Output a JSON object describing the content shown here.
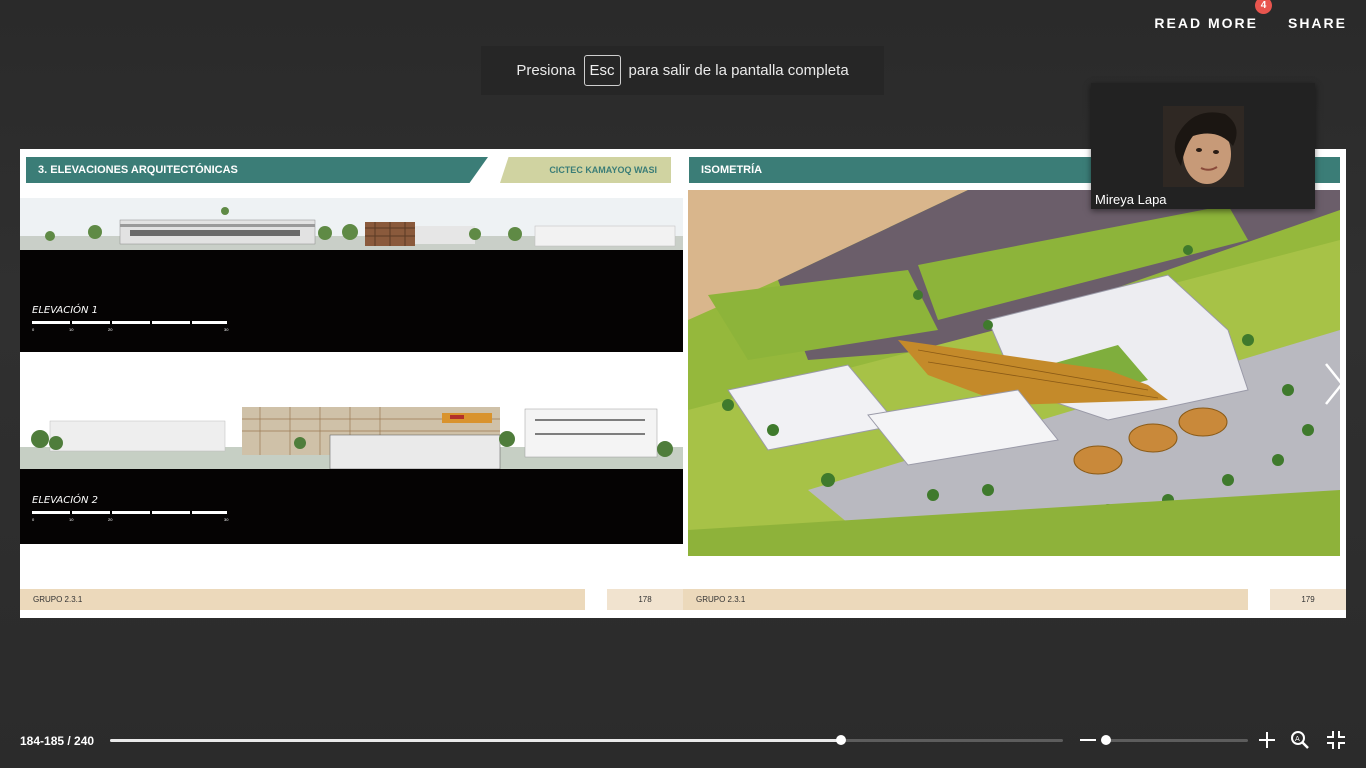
{
  "topbar": {
    "read_more_label": "READ MORE",
    "read_more_badge": "4",
    "share_label": "SHARE"
  },
  "fullscreen_notice": {
    "prefix": "Presiona",
    "key": "Esc",
    "suffix": "para salir de la pantalla completa"
  },
  "left_page": {
    "section_title": "3. ELEVACIONES ARQUITECTÓNICAS",
    "project_tag": "CICTEC KAMAYOQ WASI",
    "elevation_1_label": "ELEVACIÓN 1",
    "elevation_2_label": "ELEVACIÓN 2",
    "scale_ticks": [
      "0",
      "10",
      "20",
      "30"
    ],
    "footer_group": "GRUPO 2.3.1",
    "page_number": "178"
  },
  "right_page": {
    "section_title": "ISOMETRÍA",
    "footer_group": "GRUPO 2.3.1",
    "page_number": "179"
  },
  "video_tile": {
    "participant_name": "Mireya Lapa"
  },
  "bottom_bar": {
    "page_indicator": "184-185 / 240",
    "progress_fraction": 0.767,
    "zoom_fraction": 0.0
  },
  "icons": {
    "prev": "chevron-left-icon",
    "next": "chevron-right-icon",
    "zoom_out": "minus-icon",
    "zoom_in": "plus-icon",
    "magnifier": "zoom-search-icon",
    "exit_fullscreen": "exit-fullscreen-icon"
  },
  "colors": {
    "section_band": "#3b7d77",
    "tag_band": "#d0d3a1",
    "footer_band": "#ecd9bb",
    "badge": "#e8554e"
  }
}
